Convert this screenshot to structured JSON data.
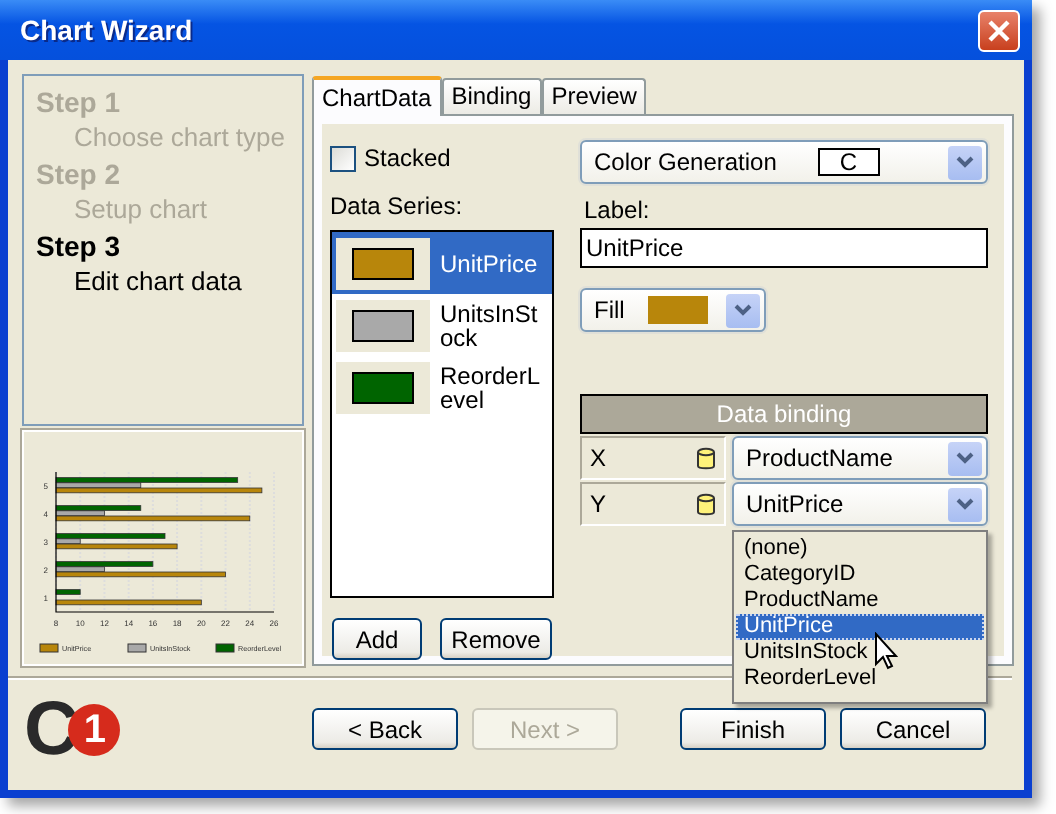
{
  "window": {
    "title": "Chart Wizard"
  },
  "steps": [
    {
      "label": "Step 1",
      "description": "Choose chart type",
      "selected": false
    },
    {
      "label": "Step 2",
      "description": "Setup chart",
      "selected": false
    },
    {
      "label": "Step 3",
      "description": "Edit chart data",
      "selected": true
    }
  ],
  "preview": {
    "chart_data": {
      "type": "bar",
      "orientation": "horizontal",
      "categories": [
        "5",
        "4",
        "3",
        "2",
        "1"
      ],
      "series": [
        {
          "name": "UnitPrice",
          "color": "#b8860b",
          "values": [
            25,
            24,
            18,
            22,
            20
          ]
        },
        {
          "name": "UnitsInStock",
          "color": "#a9a9a9",
          "values": [
            15,
            12,
            10,
            12,
            null
          ]
        },
        {
          "name": "ReorderLevel",
          "color": "#006400",
          "values": [
            23,
            15,
            17,
            16,
            10
          ]
        }
      ],
      "grid": true,
      "legend": true,
      "xlim": [
        8,
        26
      ],
      "xticks": [
        8,
        10,
        12,
        14,
        16,
        18,
        20,
        22,
        24,
        26
      ]
    }
  },
  "tabs": [
    {
      "label": "ChartData",
      "selected": true
    },
    {
      "label": "Binding",
      "selected": false
    },
    {
      "label": "Preview",
      "selected": false
    }
  ],
  "stacked": {
    "label": "Stacked",
    "checked": false
  },
  "data_series": {
    "label": "Data Series:",
    "items": [
      {
        "name": "UnitPrice",
        "color": "#b8860b",
        "selected": true
      },
      {
        "name": "UnitsInStock",
        "color": "#a9a9a9",
        "selected": false
      },
      {
        "name": "ReorderLevel",
        "color": "#006400",
        "selected": false
      }
    ]
  },
  "series_buttons": [
    "Add",
    "Remove"
  ],
  "color_generation": {
    "label": "Color Generation",
    "value": "C"
  },
  "label_field": {
    "label": "Label:",
    "value": "UnitPrice"
  },
  "fill": {
    "label": "Fill",
    "color": "#b8860b"
  },
  "data_binding": {
    "title": "Data binding",
    "rows": [
      {
        "axis": "X",
        "value": "ProductName"
      },
      {
        "axis": "Y",
        "value": "UnitPrice"
      }
    ]
  },
  "dropdown": {
    "options": [
      {
        "label": "(none)",
        "selected": false
      },
      {
        "label": "CategoryID",
        "selected": false
      },
      {
        "label": "ProductName",
        "selected": false
      },
      {
        "label": "UnitPrice",
        "selected": true
      },
      {
        "label": "UnitsInStock",
        "selected": false
      },
      {
        "label": "ReorderLevel",
        "selected": false
      }
    ]
  },
  "logo": {
    "letter": "C",
    "digit": "1"
  },
  "buttons": [
    {
      "label": "< Back",
      "disabled": false
    },
    {
      "label": "Next >",
      "disabled": true
    },
    {
      "label": "Finish",
      "disabled": false
    },
    {
      "label": "Cancel",
      "disabled": false
    }
  ]
}
